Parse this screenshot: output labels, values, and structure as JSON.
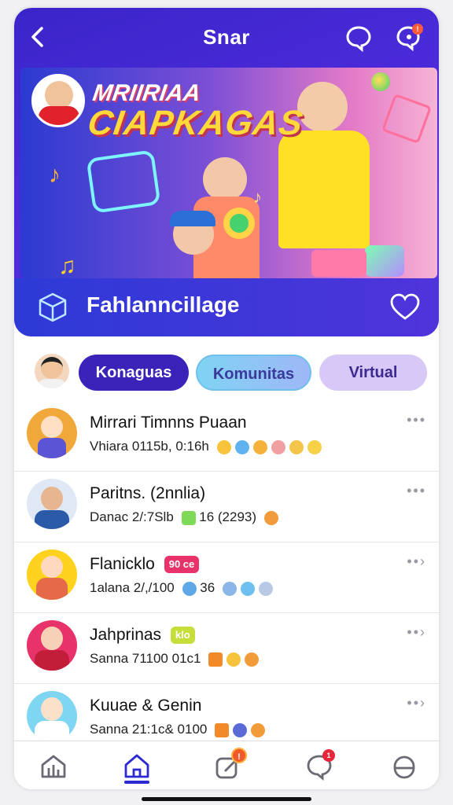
{
  "header": {
    "title": "Snar",
    "back_icon": "back-chevron-icon",
    "chat_icon": "chat-bubble-icon",
    "notification_icon": "notification-chat-icon",
    "notification_badge": "!"
  },
  "banner": {
    "title_line1": "MRIIRIAA",
    "title_line2": "CIAPKAGAS",
    "footer_title": "Fahlanncillage",
    "cube_icon": "cube-icon",
    "heart_icon": "heart-icon"
  },
  "chips": [
    {
      "label": "Konaguas"
    },
    {
      "label": "Komunitas"
    },
    {
      "label": "Virtual"
    }
  ],
  "list": [
    {
      "name": "Mirrari Timnns Puaan",
      "sub": "Vhiara 0115b, 0:16h",
      "tag": "",
      "colors": [
        "#f0a83a",
        "#ffe0c4"
      ]
    },
    {
      "name": "Paritns. (2nnlia)",
      "sub": "Danac 2/:7Slb",
      "sub2": "16 (2293)",
      "tag": "",
      "colors": [
        "#dfe8f4",
        "#2a5aa8"
      ]
    },
    {
      "name": "Flanicklo",
      "sub": "1alana 2/,/100",
      "sub2": "36",
      "tag": "90 ce",
      "colors": [
        "#ffd21f",
        "#e66a4a"
      ]
    },
    {
      "name": "Jahprinas",
      "sub": "Sanna 71100 01c1",
      "tag": "klo",
      "colors": [
        "#e8336a",
        "#f7d1b7"
      ]
    },
    {
      "name": "Kuuae & Genin",
      "sub": "Sanna 21:1c& 0100",
      "tag": "",
      "colors": [
        "#7fd6f2",
        "#fbe1c9"
      ]
    }
  ],
  "nav": {
    "items": [
      "home-stats-icon",
      "home-icon",
      "compose-icon",
      "chat-icon",
      "profile-icon"
    ],
    "compose_badge": "!",
    "chat_badge": "1"
  }
}
